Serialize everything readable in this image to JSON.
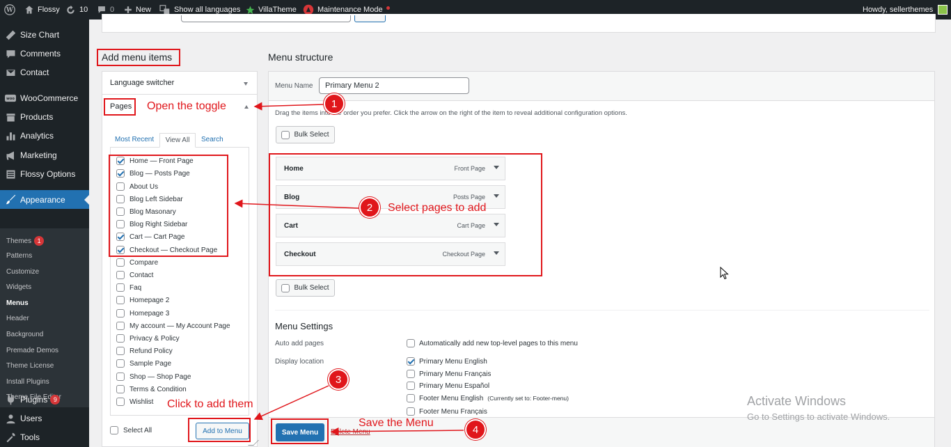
{
  "adminbar": {
    "site_name": "Flossy",
    "updates_count": "10",
    "comments_count": "0",
    "new_label": "New",
    "languages_label": "Show all languages",
    "villatheme_label": "VillaTheme",
    "maintenance_label": "Maintenance Mode",
    "howdy": "Howdy, sellerthemes"
  },
  "sidebar": {
    "items": [
      {
        "label": "Size Chart",
        "icon": "ruler-icon"
      },
      {
        "label": "Comments",
        "icon": "comment-icon"
      },
      {
        "label": "Contact",
        "icon": "mail-icon"
      },
      {
        "label": "WooCommerce",
        "icon": "woo-icon"
      },
      {
        "label": "Products",
        "icon": "archive-icon"
      },
      {
        "label": "Analytics",
        "icon": "chart-icon"
      },
      {
        "label": "Marketing",
        "icon": "megaphone-icon"
      },
      {
        "label": "Flossy Options",
        "icon": "options-icon"
      },
      {
        "label": "Appearance",
        "icon": "brush-icon"
      },
      {
        "label": "Plugins",
        "icon": "plugin-icon",
        "badge": "9"
      },
      {
        "label": "Users",
        "icon": "user-icon"
      },
      {
        "label": "Tools",
        "icon": "wrench-icon"
      }
    ],
    "sub_items": [
      {
        "label": "Themes",
        "badge": "1"
      },
      {
        "label": "Patterns"
      },
      {
        "label": "Customize"
      },
      {
        "label": "Widgets"
      },
      {
        "label": "Menus"
      },
      {
        "label": "Header"
      },
      {
        "label": "Background"
      },
      {
        "label": "Premade Demos"
      },
      {
        "label": "Theme License"
      },
      {
        "label": "Install Plugins"
      },
      {
        "label": "Theme File Editor"
      }
    ]
  },
  "add_items": {
    "heading": "Add menu items",
    "language_switcher": "Language switcher",
    "pages_label": "Pages",
    "tabs": [
      "Most Recent",
      "View All",
      "Search"
    ],
    "pages": [
      {
        "label": "Home — Front Page",
        "checked": true
      },
      {
        "label": "Blog — Posts Page",
        "checked": true
      },
      {
        "label": "About Us",
        "checked": false
      },
      {
        "label": "Blog Left Sidebar",
        "checked": false
      },
      {
        "label": "Blog Masonary",
        "checked": false
      },
      {
        "label": "Blog Right Sidebar",
        "checked": false
      },
      {
        "label": "Cart — Cart Page",
        "checked": true
      },
      {
        "label": "Checkout — Checkout Page",
        "checked": true
      },
      {
        "label": "Compare",
        "checked": false
      },
      {
        "label": "Contact",
        "checked": false
      },
      {
        "label": "Faq",
        "checked": false
      },
      {
        "label": "Homepage 2",
        "checked": false
      },
      {
        "label": "Homepage 3",
        "checked": false
      },
      {
        "label": "My account — My Account Page",
        "checked": false
      },
      {
        "label": "Privacy & Policy",
        "checked": false
      },
      {
        "label": "Refund Policy",
        "checked": false
      },
      {
        "label": "Sample Page",
        "checked": false
      },
      {
        "label": "Shop — Shop Page",
        "checked": false
      },
      {
        "label": "Terms & Condition",
        "checked": false
      },
      {
        "label": "Wishlist",
        "checked": false
      }
    ],
    "select_all": "Select All",
    "add_button": "Add to Menu"
  },
  "structure": {
    "heading": "Menu structure",
    "menu_name_label": "Menu Name",
    "menu_name_value": "Primary Menu 2",
    "instructions": "Drag the items into the order you prefer. Click the arrow on the right of the item to reveal additional configuration options.",
    "bulk_select": "Bulk Select",
    "items": [
      {
        "title": "Home",
        "type": "Front Page"
      },
      {
        "title": "Blog",
        "type": "Posts Page"
      },
      {
        "title": "Cart",
        "type": "Cart Page"
      },
      {
        "title": "Checkout",
        "type": "Checkout Page"
      }
    ],
    "settings_heading": "Menu Settings",
    "auto_add_label": "Auto add pages",
    "auto_add_option": "Automatically add new top-level pages to this menu",
    "display_location_label": "Display location",
    "locations": [
      {
        "label": "Primary Menu English",
        "note": "",
        "checked": true
      },
      {
        "label": "Primary Menu Français",
        "note": "",
        "checked": false
      },
      {
        "label": "Primary Menu Español",
        "note": "",
        "checked": false
      },
      {
        "label": "Footer Menu English",
        "note": "(Currently set to: Footer-menu)",
        "checked": false
      },
      {
        "label": "Footer Menu Français",
        "note": "",
        "checked": false
      }
    ],
    "save_button": "Save Menu",
    "delete_link": "Delete Menu"
  },
  "annotations": {
    "step1_num": "1",
    "step1_text": "Open the toggle",
    "step2_num": "2",
    "step2_text": "Select pages to add",
    "step3_num": "3",
    "step3_text": "Click to add them",
    "step4_num": "4",
    "step4_text": "Save the Menu"
  },
  "watermark": {
    "title": "Activate Windows",
    "subtitle": "Go to Settings to activate Windows."
  },
  "colors": {
    "accent": "#2271b1",
    "annotation": "#e0161b",
    "adminbar": "#1d2327"
  }
}
